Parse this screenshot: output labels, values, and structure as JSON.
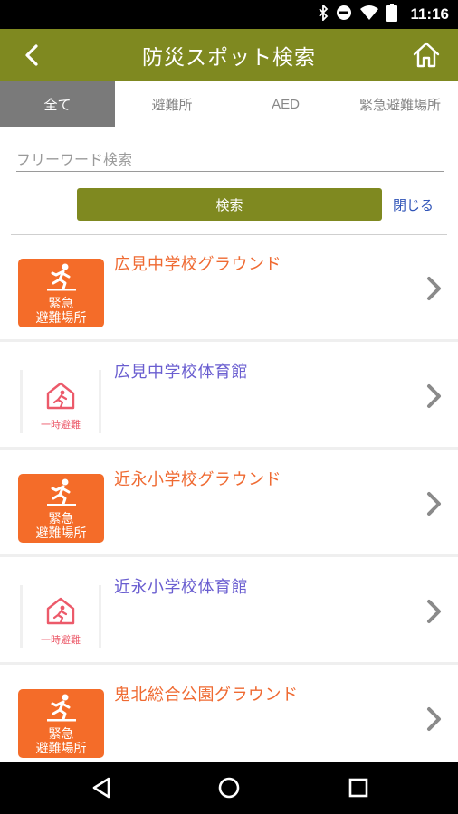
{
  "status_bar": {
    "time": "11:16",
    "icons": [
      "bluetooth-icon",
      "do-not-disturb-icon",
      "wifi-icon",
      "battery-icon"
    ]
  },
  "app_bar": {
    "title": "防災スポット検索",
    "back_icon": "back-arrow-icon",
    "home_icon": "home-icon",
    "color": "#7f8920"
  },
  "tabs": [
    {
      "label": "全て",
      "active": true
    },
    {
      "label": "避難所",
      "active": false
    },
    {
      "label": "AED",
      "active": false
    },
    {
      "label": "緊急避難場所",
      "active": false
    }
  ],
  "search": {
    "placeholder": "フリーワード検索",
    "button_label": "検索",
    "close_label": "閉じる"
  },
  "badges": {
    "emergency_line1": "緊急",
    "emergency_line2": "避難場所",
    "temporary": "一時避難"
  },
  "list": [
    {
      "name": "広見中学校グラウンド",
      "type": "emergency"
    },
    {
      "name": "広見中学校体育館",
      "type": "temporary"
    },
    {
      "name": "近永小学校グラウンド",
      "type": "emergency"
    },
    {
      "name": "近永小学校体育館",
      "type": "temporary"
    },
    {
      "name": "鬼北総合公園グラウンド",
      "type": "emergency"
    }
  ],
  "colors": {
    "accent": "#7f8920",
    "emergency": "#f46c29",
    "emergency_text": "#ef6a32",
    "temporary_text": "#6a5ed0",
    "temporary_icon": "#ec5a6a",
    "link": "#3155b8"
  },
  "nav_bar": {
    "icons": [
      "nav-back-icon",
      "nav-home-icon",
      "nav-recents-icon"
    ]
  }
}
